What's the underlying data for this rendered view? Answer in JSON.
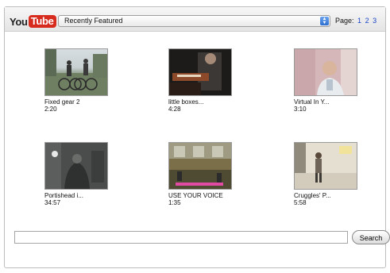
{
  "header": {
    "logo_text_you": "You",
    "logo_text_tube": "Tube",
    "feed_select": "Recently Featured",
    "pager_label": "Page:",
    "pages": [
      "1",
      "2",
      "3"
    ]
  },
  "videos": [
    {
      "title": "Fixed gear 2",
      "duration": "2:20"
    },
    {
      "title": "little boxes...",
      "duration": "4:28"
    },
    {
      "title": "Virtual In Y...",
      "duration": "3:10"
    },
    {
      "title": "Portishead i...",
      "duration": "34:57"
    },
    {
      "title": "USE YOUR VOICE",
      "duration": "1:35"
    },
    {
      "title": "Cruggles' P...",
      "duration": "5:58"
    }
  ],
  "search": {
    "value": "",
    "button_label": "Search"
  },
  "icons": {
    "select_arrows": "updown-arrows-icon"
  },
  "colors": {
    "logo_red": "#d62b1d",
    "link_blue": "#1a44c8"
  }
}
